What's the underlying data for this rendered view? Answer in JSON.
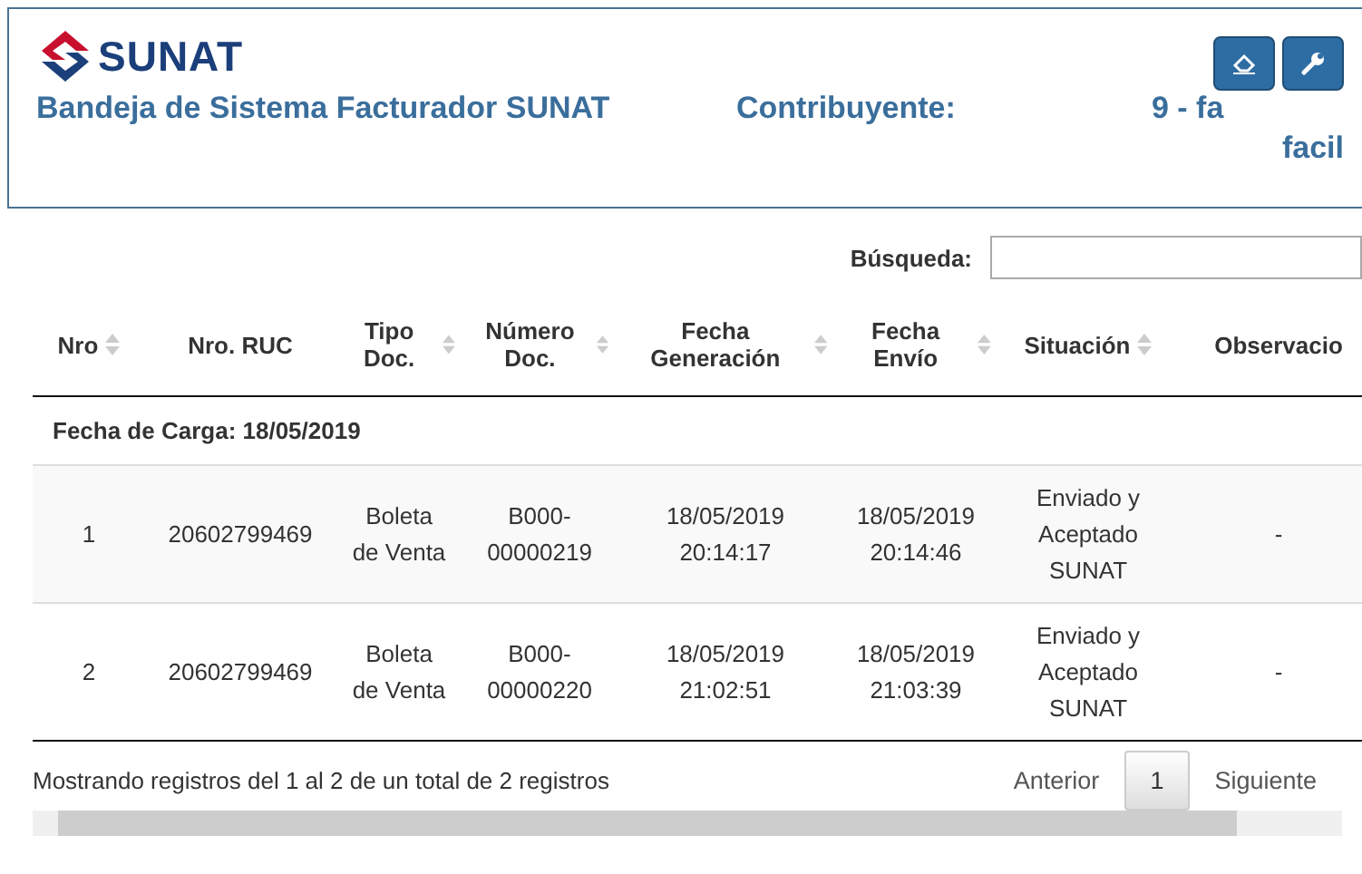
{
  "header": {
    "logo_text": "SUNAT",
    "title": "Bandeja de Sistema Facturador SUNAT",
    "contributor_label": "Contribuyente:",
    "contributor_value": "9 - fa",
    "contributor_value_line2": "facil"
  },
  "search": {
    "label": "Búsqueda:"
  },
  "table": {
    "columns": [
      {
        "label": "Nro",
        "sortable": true
      },
      {
        "label": "Nro. RUC",
        "sortable": false
      },
      {
        "label": "Tipo Doc.",
        "sortable": true
      },
      {
        "label": "Número Doc.",
        "sortable": true
      },
      {
        "label": "Fecha Generación",
        "sortable": true
      },
      {
        "label": "Fecha Envío",
        "sortable": true
      },
      {
        "label": "Situación",
        "sortable": true
      },
      {
        "label": "Observacio",
        "sortable": false
      }
    ],
    "group": "Fecha de Carga: 18/05/2019",
    "rows": [
      [
        "1",
        "20602799469",
        "Boleta de Venta",
        "B000-00000219",
        "18/05/2019 20:14:17",
        "18/05/2019 20:14:46",
        "Enviado y Aceptado SUNAT",
        "-"
      ],
      [
        "2",
        "20602799469",
        "Boleta de Venta",
        "B000-00000220",
        "18/05/2019 21:02:51",
        "18/05/2019 21:03:39",
        "Enviado y Aceptado SUNAT",
        "-"
      ]
    ]
  },
  "footer": {
    "info": "Mostrando registros del 1 al 2 de un total de 2 registros",
    "pagination": [
      {
        "label": "Anterior",
        "selected": false
      },
      {
        "label": "1",
        "selected": true
      },
      {
        "label": "Siguiente",
        "selected": false
      }
    ]
  }
}
